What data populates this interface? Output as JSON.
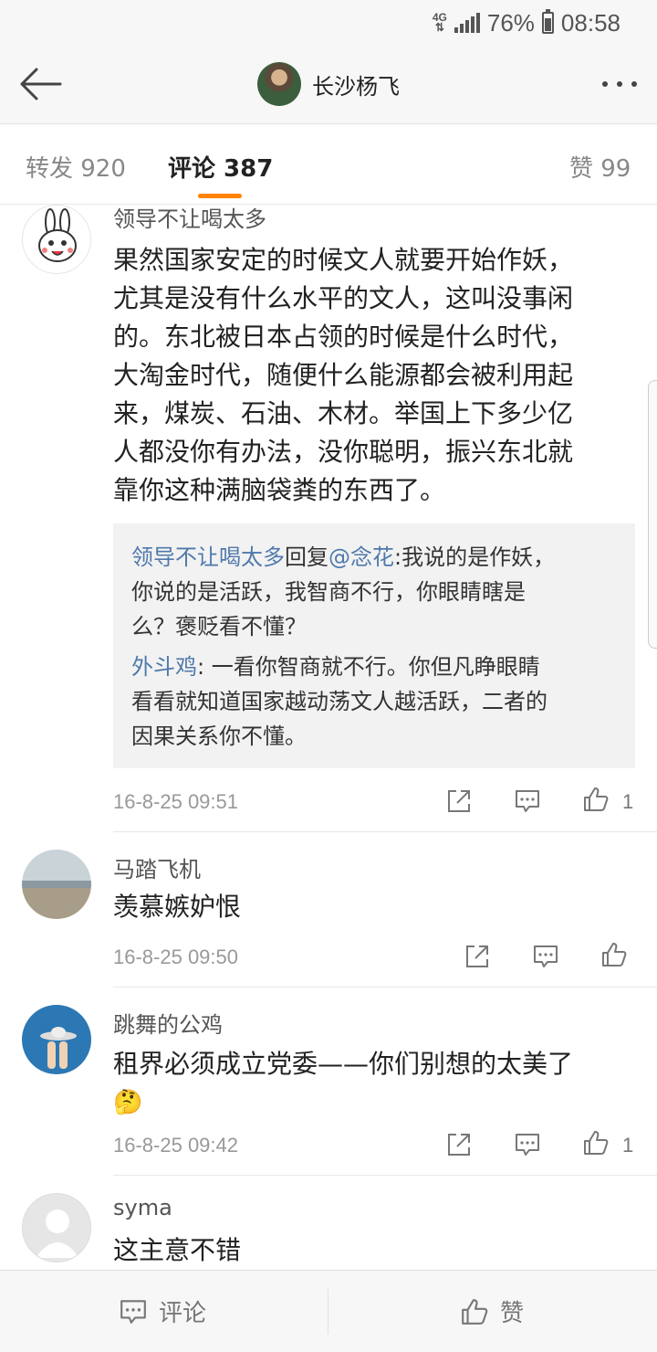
{
  "status_bar": {
    "network": "4G",
    "battery": "76%",
    "time": "08:58"
  },
  "header": {
    "title": "长沙杨飞"
  },
  "tabs": [
    {
      "label": "转发 920"
    },
    {
      "label": "评论 387",
      "active": true
    },
    {
      "label": "赞 99"
    }
  ],
  "comments": [
    {
      "author": "领导不让喝太多",
      "lines": [
        "果然国家安定的时候文人就要开始作妖，",
        "尤其是没有什么水平的文人，这叫没事闲",
        "的。东北被日本占领的时候是什么时代，",
        "大淘金时代，随便什么能源都会被利用起",
        "来，煤炭、石油、木材。举国上下多少亿",
        "人都没你有办法，没你聪明，振兴东北就",
        "靠你这种满脑袋粪的东西了。"
      ],
      "replies": [
        {
          "author": "领导不让喝太多",
          "reply_word": "回复",
          "mention": "@念花",
          "lines": [
            ":我说的是作妖，",
            "你说的是活跃，我智商不行，你眼睛瞎是",
            "么？褒贬看不懂？"
          ]
        },
        {
          "author": "外斗鸡",
          "lines": [
            ": 一看你智商就不行。你但凡睁眼睛",
            "看看就知道国家越动荡文人越活跃，二者的",
            "因果关系你不懂。"
          ]
        }
      ],
      "time": "16-8-25 09:51",
      "likes": "1"
    },
    {
      "author": "马踏飞机",
      "text": "羡慕嫉妒恨",
      "time": "16-8-25 09:50",
      "likes": ""
    },
    {
      "author": "跳舞的公鸡",
      "text": "租界必须成立党委——你们别想的太美了",
      "emoji": "🤔",
      "time": "16-8-25 09:42",
      "likes": "1"
    },
    {
      "author": "syma",
      "text": "这主意不错"
    }
  ],
  "bottom_bar": {
    "comment_label": "评论",
    "like_label": "赞"
  },
  "colors": {
    "accent": "#ff8200",
    "link": "#4f79ab"
  }
}
